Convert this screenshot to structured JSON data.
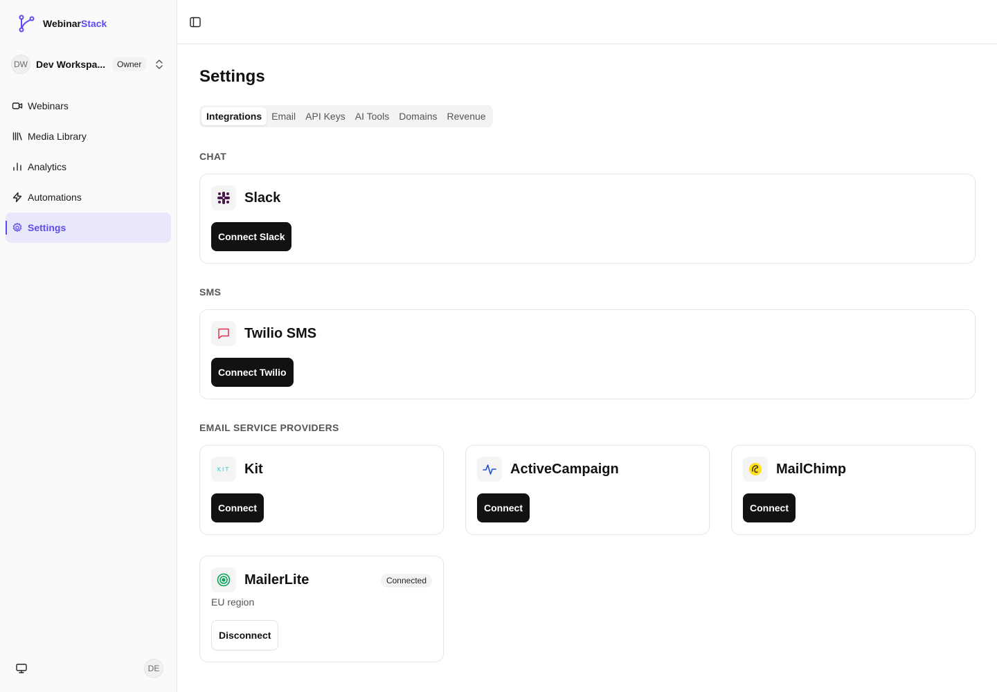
{
  "brand": {
    "name_part1": "Webinar",
    "name_part2": "Stack"
  },
  "workspace": {
    "initials": "DW",
    "name": "Dev Workspa...",
    "role": "Owner"
  },
  "nav": [
    {
      "label": "Webinars",
      "icon": "video-icon"
    },
    {
      "label": "Media Library",
      "icon": "library-icon"
    },
    {
      "label": "Analytics",
      "icon": "bar-chart-icon"
    },
    {
      "label": "Automations",
      "icon": "zap-icon"
    },
    {
      "label": "Settings",
      "icon": "gear-icon",
      "active": true
    }
  ],
  "footer": {
    "user_initials": "DE"
  },
  "page": {
    "title": "Settings"
  },
  "tabs": [
    "Integrations",
    "Email",
    "API Keys",
    "AI Tools",
    "Domains",
    "Revenue"
  ],
  "sections": {
    "chat": "CHAT",
    "sms": "SMS",
    "email_providers": "EMAIL SERVICE PROVIDERS"
  },
  "integrations": {
    "slack": {
      "name": "Slack",
      "button": "Connect Slack"
    },
    "twilio": {
      "name": "Twilio SMS",
      "button": "Connect Twilio"
    },
    "kit": {
      "name": "Kit",
      "logo_text": "KIT",
      "button": "Connect"
    },
    "activecampaign": {
      "name": "ActiveCampaign",
      "button": "Connect"
    },
    "mailchimp": {
      "name": "MailChimp",
      "button": "Connect"
    },
    "mailerlite": {
      "name": "MailerLite",
      "status": "Connected",
      "region": "EU region",
      "button": "Disconnect"
    }
  },
  "colors": {
    "accent": "#5b4cf0",
    "button_dark": "#121212",
    "active_nav_bg": "#e9e8fb"
  }
}
